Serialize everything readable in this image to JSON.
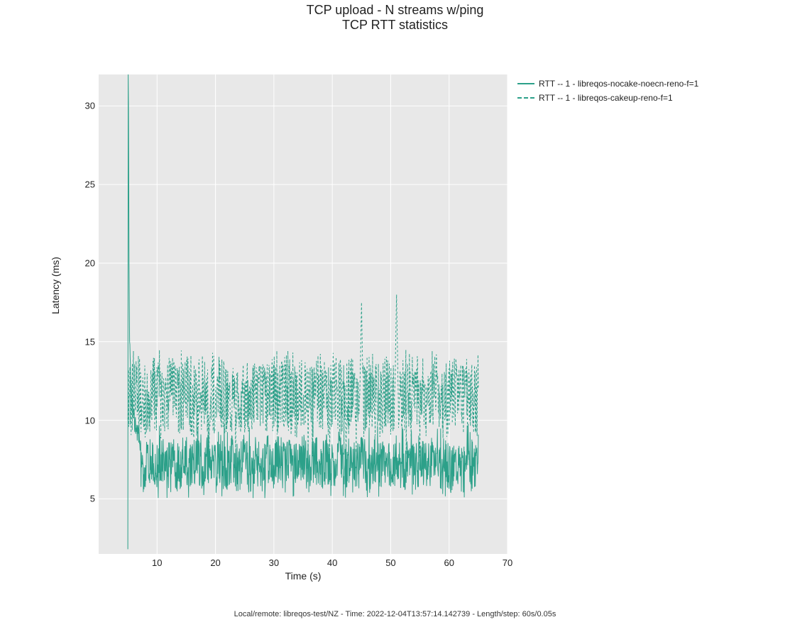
{
  "title": "TCP upload - N streams w/ping",
  "subtitle": "TCP RTT statistics",
  "xlabel": "Time (s)",
  "ylabel": "Latency (ms)",
  "footer": "Local/remote: libreqos-test/NZ - Time: 2022-12-04T13:57:14.142739 - Length/step: 60s/0.05s",
  "legend": {
    "series1": "RTT -- 1 - libreqos-nocake-noecn-reno-f=1",
    "series2": "RTT -- 1 - libreqos-cakeup-reno-f=1"
  },
  "xticks": [
    10,
    20,
    30,
    40,
    50,
    60,
    70
  ],
  "yticks": [
    5,
    10,
    15,
    20,
    25,
    30
  ],
  "chart_data": {
    "type": "line",
    "xlabel": "Time (s)",
    "ylabel": "Latency (ms)",
    "title": "TCP upload - N streams w/ping — TCP RTT statistics",
    "xlim": [
      0,
      70
    ],
    "ylim": [
      1.5,
      32
    ],
    "grid": true,
    "legend_position": "upper-right-outside",
    "accent_color": "#2ca089",
    "series": [
      {
        "name": "RTT -- 1 - libreqos-nocake-noecn-reno-f=1",
        "style": "solid",
        "x": [
          5,
          5.05,
          5.1,
          5.15,
          5.2,
          5.3,
          5.5,
          6,
          6.5,
          7,
          8,
          9,
          10,
          12,
          14,
          16,
          18,
          20,
          22,
          24,
          26,
          28,
          30,
          32,
          34,
          36,
          38,
          40,
          42,
          44,
          45,
          46,
          48,
          50,
          51,
          52,
          54,
          56,
          58,
          60,
          62,
          64,
          65
        ],
        "y": [
          1.8,
          32,
          30,
          25,
          20,
          15,
          12,
          10,
          9.5,
          9,
          8.5,
          8,
          7.5,
          8,
          7.5,
          7.8,
          7,
          7.5,
          7.2,
          7,
          7.4,
          7,
          7.2,
          7.5,
          7,
          7.3,
          7,
          7.4,
          7.2,
          7,
          7.5,
          7.3,
          7,
          7.2,
          7,
          7.3,
          7,
          7.5,
          7.2,
          7,
          7.3,
          7.2,
          7.5
        ],
        "band_min": 5.5,
        "band_max": 9.0,
        "note": "After an initial spike to 32 ms at ~5 s, the solid series settles into a noisy band roughly 5.5-9 ms for the remainder of the run."
      },
      {
        "name": "RTT -- 1 - libreqos-cakeup-reno-f=1",
        "style": "dashed",
        "x": [
          5,
          5.5,
          6,
          7,
          8,
          10,
          12,
          14,
          16,
          18,
          20,
          22,
          24,
          26,
          28,
          30,
          32,
          34,
          36,
          38,
          40,
          42,
          44,
          45,
          46,
          48,
          50,
          51,
          52,
          54,
          56,
          58,
          60,
          62,
          64,
          65
        ],
        "y": [
          12,
          13,
          12,
          12.5,
          12,
          11,
          11.5,
          11,
          11.5,
          10.5,
          11,
          11.5,
          11,
          11,
          11.5,
          10.5,
          11,
          11,
          11.5,
          11,
          11,
          11,
          11.5,
          17.5,
          11,
          11,
          11.5,
          18,
          11,
          11,
          11.5,
          11,
          11,
          11.5,
          11,
          11.5
        ],
        "band_min": 8.0,
        "band_max": 14.0,
        "spikes": [
          {
            "x": 45,
            "y": 17.5
          },
          {
            "x": 51,
            "y": 18.0
          }
        ],
        "note": "Dashed series is a noisy band roughly 8-14 ms with two isolated spikes to ~17.5 ms and ~18 ms."
      }
    ]
  }
}
